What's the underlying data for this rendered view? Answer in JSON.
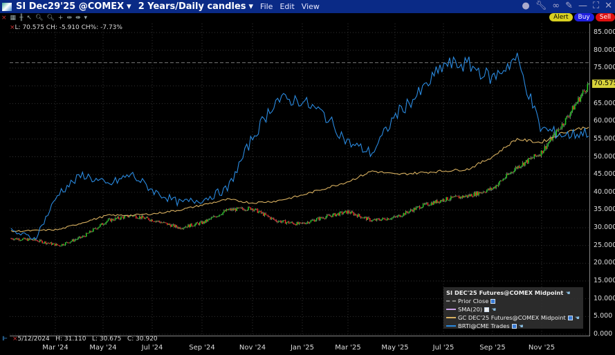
{
  "title": {
    "symbol": "SI Dec29'25 @COMEX",
    "period": "2 Years/Daily candles",
    "menus": [
      "File",
      "Edit",
      "View"
    ]
  },
  "order_buttons": {
    "alert": "Alert",
    "buy": "Buy",
    "sell": "Sell"
  },
  "info_top": "L: 70.575 CH: -5.910 CH%: -7.73%",
  "info_bottom": "5/12/2024   H: 31.110   L: 30.675   C: 30.920",
  "last_price": "70.575",
  "legend": {
    "title": "SI DEC'25 Futures@COMEX Midpoint",
    "items": [
      {
        "label": "Prior Close",
        "checked": true,
        "color": "#888888"
      },
      {
        "label": "SMA(20)",
        "checked": false,
        "color": "#c8a0e8"
      },
      {
        "label": "GC DEC'25 Futures@COMEX Midpoint",
        "checked": true,
        "color": "#d8b060"
      },
      {
        "label": "BRTI@CME Trades",
        "checked": true,
        "color": "#2a8ae0"
      }
    ]
  },
  "chart_data": {
    "type": "line",
    "yticks": [
      "85.000",
      "80.000",
      "75.000",
      "70.000",
      "65.000",
      "60.000",
      "55.000",
      "50.000",
      "45.000",
      "40.000",
      "35.000",
      "30.000",
      "25.000",
      "20.000",
      "15.000",
      "10.000",
      "5.000",
      "0.000"
    ],
    "ylim": [
      0,
      85
    ],
    "xticks": [
      "Mar '24",
      "May '24",
      "Jul '24",
      "Sep '24",
      "Nov '24",
      "Jan '25",
      "Mar '25",
      "May '25",
      "Jul '25",
      "Sep '25",
      "Nov '25"
    ],
    "prior_close": 76.5,
    "x": [
      "2024-01",
      "2024-02",
      "2024-03",
      "2024-04",
      "2024-05",
      "2024-06",
      "2024-07",
      "2024-08",
      "2024-09",
      "2024-10",
      "2024-11",
      "2024-12",
      "2025-01",
      "2025-02",
      "2025-03",
      "2025-04",
      "2025-05",
      "2025-06",
      "2025-07",
      "2025-08",
      "2025-09",
      "2025-10",
      "2025-11",
      "2025-12a",
      "2025-12b"
    ],
    "series": [
      {
        "name": "SI DEC'25 Futures@COMEX Midpoint",
        "kind": "candle",
        "colors": {
          "up": "#22cc22",
          "down": "#ee2222"
        },
        "values": [
          27,
          26.5,
          25,
          27.5,
          32,
          33.5,
          32,
          30,
          31.5,
          35,
          35.5,
          32,
          31,
          33,
          34.5,
          32,
          33,
          36,
          38,
          39,
          41,
          47,
          51,
          60,
          70.575
        ]
      },
      {
        "name": "GC DEC'25 Futures@COMEX Midpoint",
        "kind": "line",
        "color": "#d8b060",
        "values": [
          29,
          29.2,
          29.5,
          31.5,
          33.5,
          33.5,
          34,
          35,
          36.5,
          38,
          37,
          37.5,
          39,
          41,
          43,
          46,
          45,
          45.5,
          46,
          46.5,
          50,
          55,
          54,
          57,
          58.5
        ]
      },
      {
        "name": "BRTI@CME Trades",
        "kind": "line",
        "color": "#2a8ae0",
        "values": [
          29,
          27,
          40,
          45,
          42,
          45,
          40,
          37,
          38,
          41,
          55,
          66,
          66,
          62,
          54,
          51,
          62,
          68,
          76,
          76,
          72,
          78,
          58,
          56,
          57
        ]
      }
    ]
  }
}
